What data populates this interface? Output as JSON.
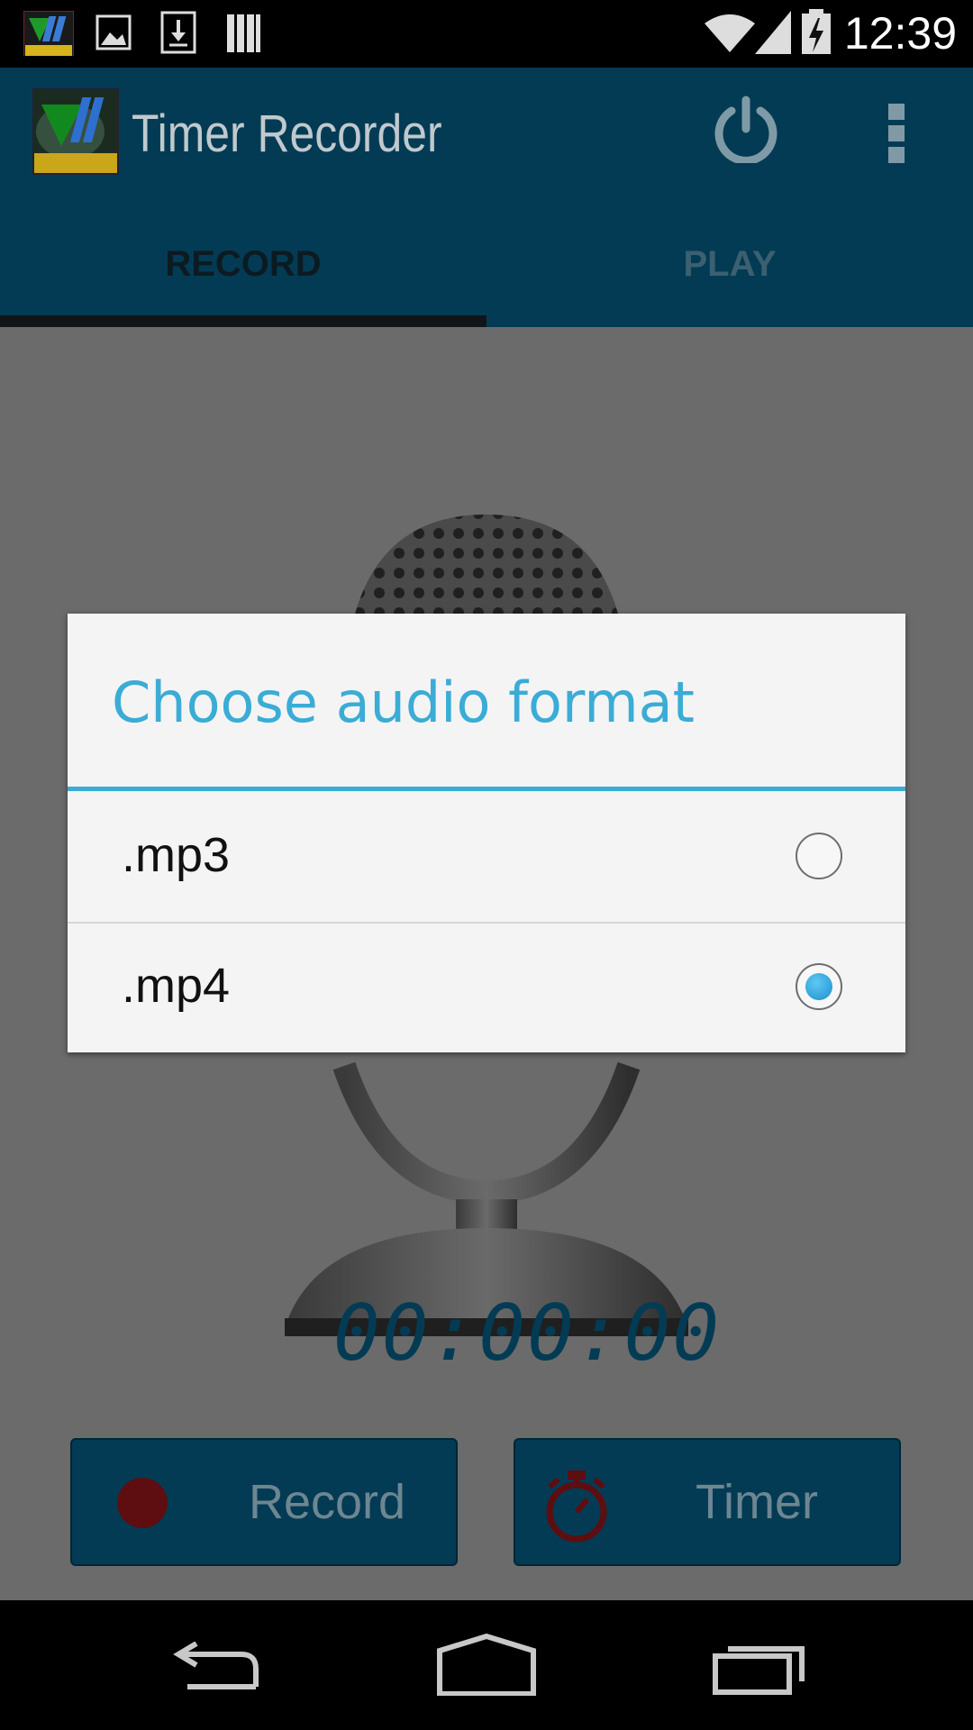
{
  "status_bar": {
    "time": "12:39"
  },
  "action_bar": {
    "title": "Timer Recorder"
  },
  "tabs": [
    {
      "label": "RECORD",
      "selected": true
    },
    {
      "label": "PLAY",
      "selected": false
    }
  ],
  "timer": {
    "display": "00:00:00"
  },
  "buttons": {
    "record_label": "Record",
    "timer_label": "Timer"
  },
  "dialog": {
    "title": "Choose audio format",
    "options": [
      {
        "label": ".mp3",
        "selected": false
      },
      {
        "label": ".mp4",
        "selected": true
      }
    ]
  },
  "colors": {
    "accent": "#3aacd6",
    "action_bar": "#033b54",
    "radio_selected": "#1a8fcf"
  }
}
